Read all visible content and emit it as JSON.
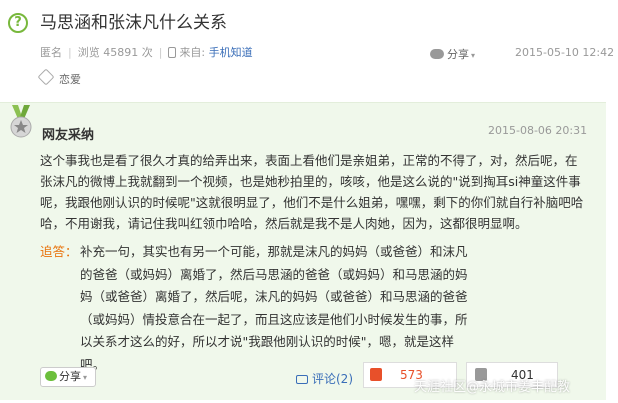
{
  "question": {
    "icon": "question-icon",
    "title": "马思涵和张沫凡什么关系",
    "meta": {
      "author": "匿名",
      "views": "浏览 45891 次",
      "source_prefix": "来自:",
      "source": "手机知道",
      "share": "分享",
      "date": "2015-05-10 12:42"
    },
    "tag": "恋爱"
  },
  "answer": {
    "author": "网友采纳",
    "date": "2015-08-06 20:31",
    "body": "这个事我也是看了很久才真的给弄出来，表面上看他们是亲姐弟，正常的不得了，对，然后呢，在张沫凡的微博上我就翻到一个视频，也是她秒拍里的，咳咳，他是这么说的\"说到掏耳si神童这件事呢，我跟他刚认识的时候呢\"这就很明显了，他们不是什么姐弟，嘿嘿，剩下的你们就自行补脑吧哈哈，不用谢我，请记住我叫红领巾哈哈，然后就是我不是人肉她，因为，这都很明显啊。",
    "follow_label": "追答：",
    "follow_text": "补充一句，其实也有另一个可能，那就是沫凡的妈妈（或爸爸）和沫凡的爸爸（或妈妈）离婚了，然后马思涵的爸爸（或妈妈）和马思涵的妈妈（或爸爸）离婚了，然后呢，沫凡的妈妈（或爸爸）和马思涵的爸爸（或妈妈）情投意合在一起了，而且这应该是他们小时候发生的事，所以关系才这么的好，所以才说\"我跟他刚认识的时候\"，嗯，就是这样吧。",
    "share_label": "分享",
    "comment_label": "评论(2)",
    "upvotes": "573",
    "downvotes": "401"
  },
  "watermark": "天涯社区@永城市姜丰配教",
  "colors": {
    "accent_green": "#78b83c",
    "answer_bg": "#f0f8eb",
    "link_blue": "#3a6eb8",
    "orange": "#e8730c",
    "upvote_red": "#e8502a"
  }
}
